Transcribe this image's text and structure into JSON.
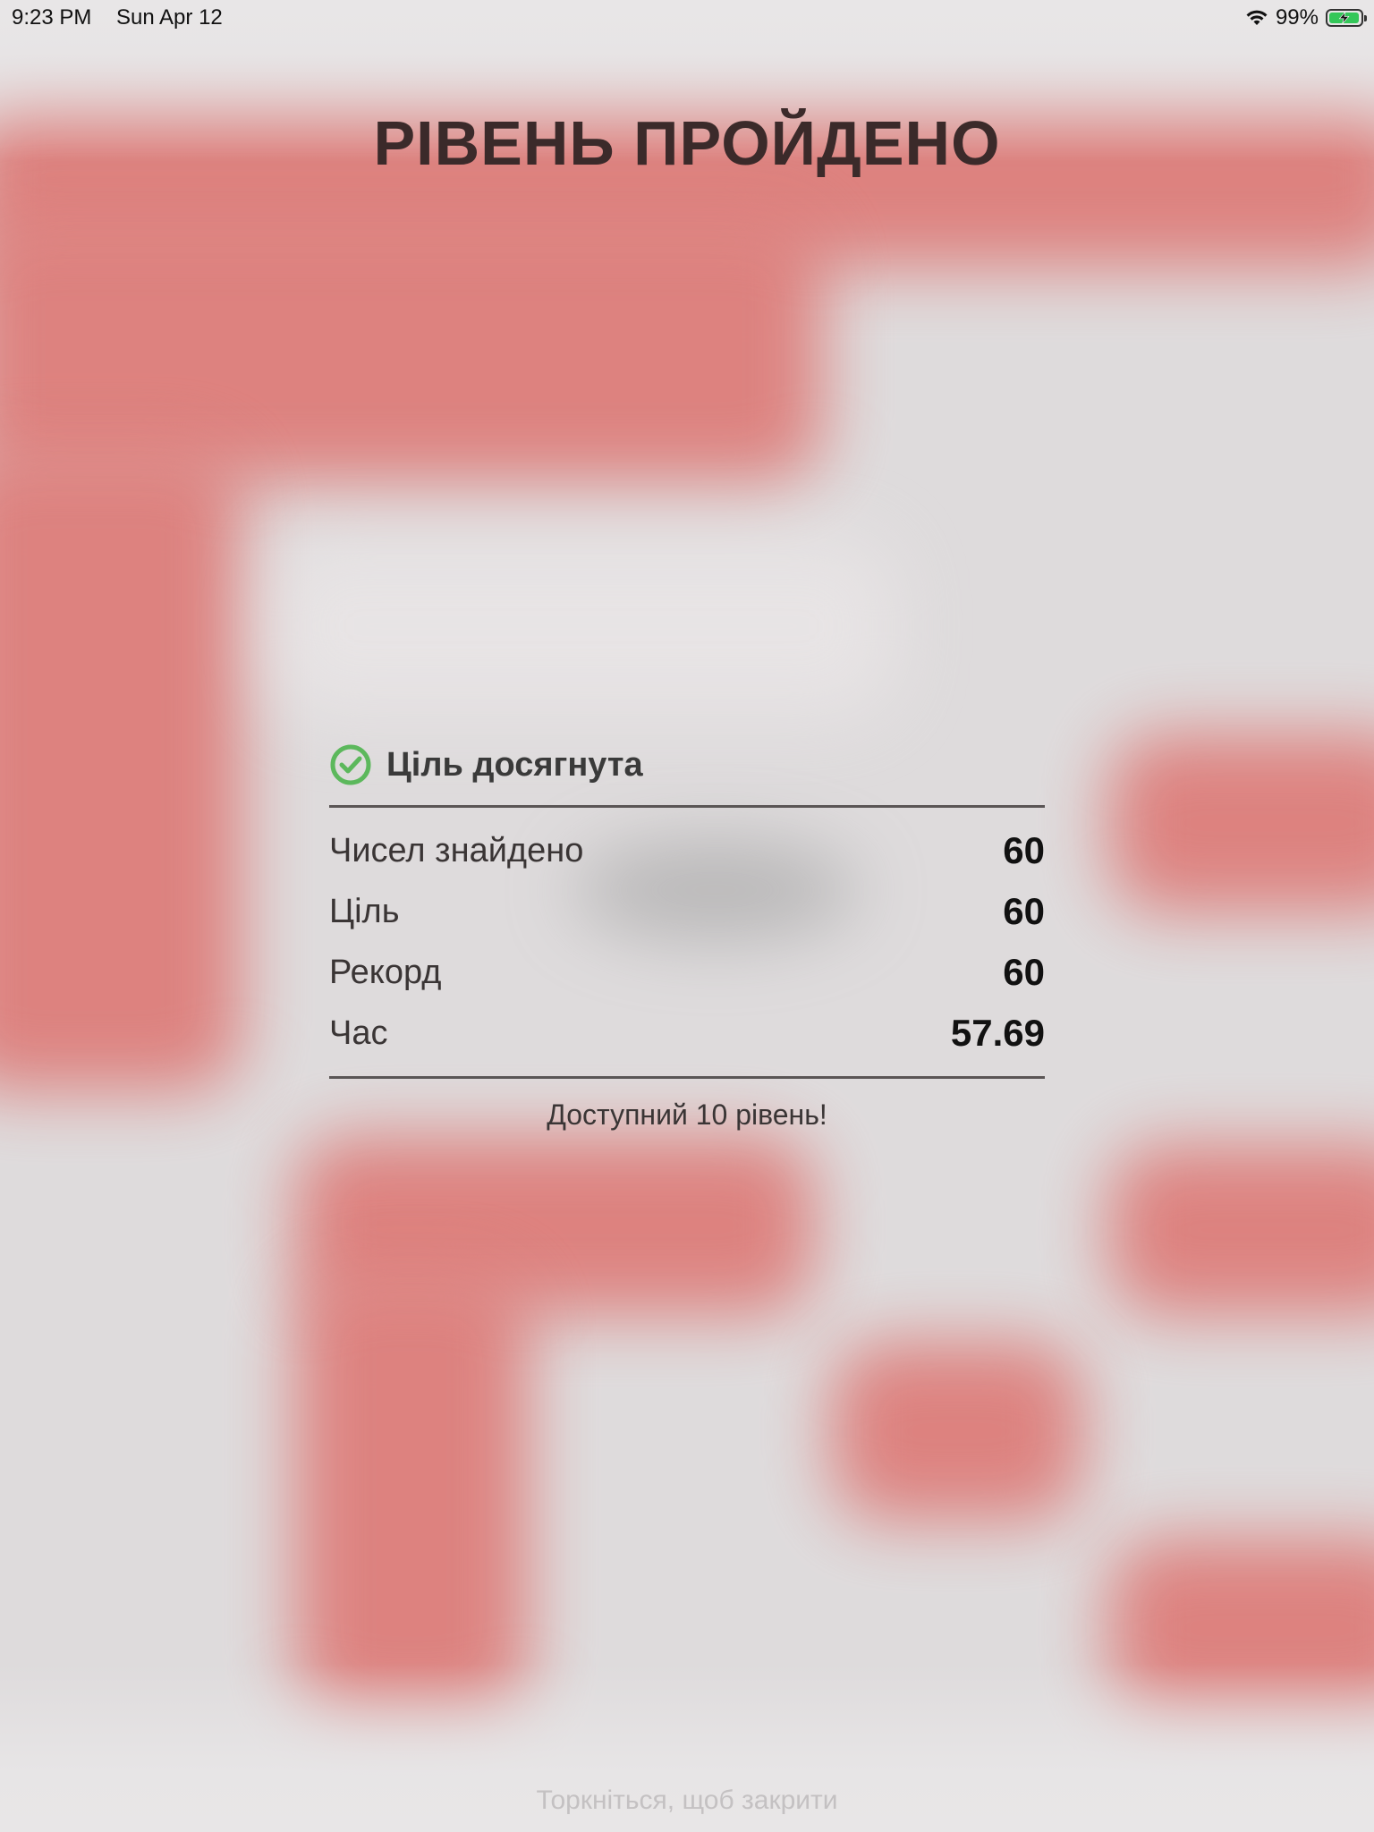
{
  "status_bar": {
    "time": "9:23 PM",
    "date": "Sun Apr 12",
    "battery": "99%",
    "wifi_icon": "wifi-icon",
    "battery_icon": "battery-charging-icon"
  },
  "title": "РІВЕНЬ ПРОЙДЕНО",
  "goal": {
    "icon": "check-circle-icon",
    "label": "Ціль досягнута",
    "icon_color": "#5cb85c"
  },
  "stats": [
    {
      "label": "Чисел знайдено",
      "value": "60"
    },
    {
      "label": "Ціль",
      "value": "60"
    },
    {
      "label": "Рекорд",
      "value": "60"
    },
    {
      "label": "Час",
      "value": "57.69"
    }
  ],
  "unlock_message": "Доступний 10 рівень!",
  "dismiss_hint": "Торкніться, щоб закрити",
  "colors": {
    "board_red": "#dd7e7b",
    "board_light": "#dedbdc",
    "title_text": "#3b2a2a"
  }
}
